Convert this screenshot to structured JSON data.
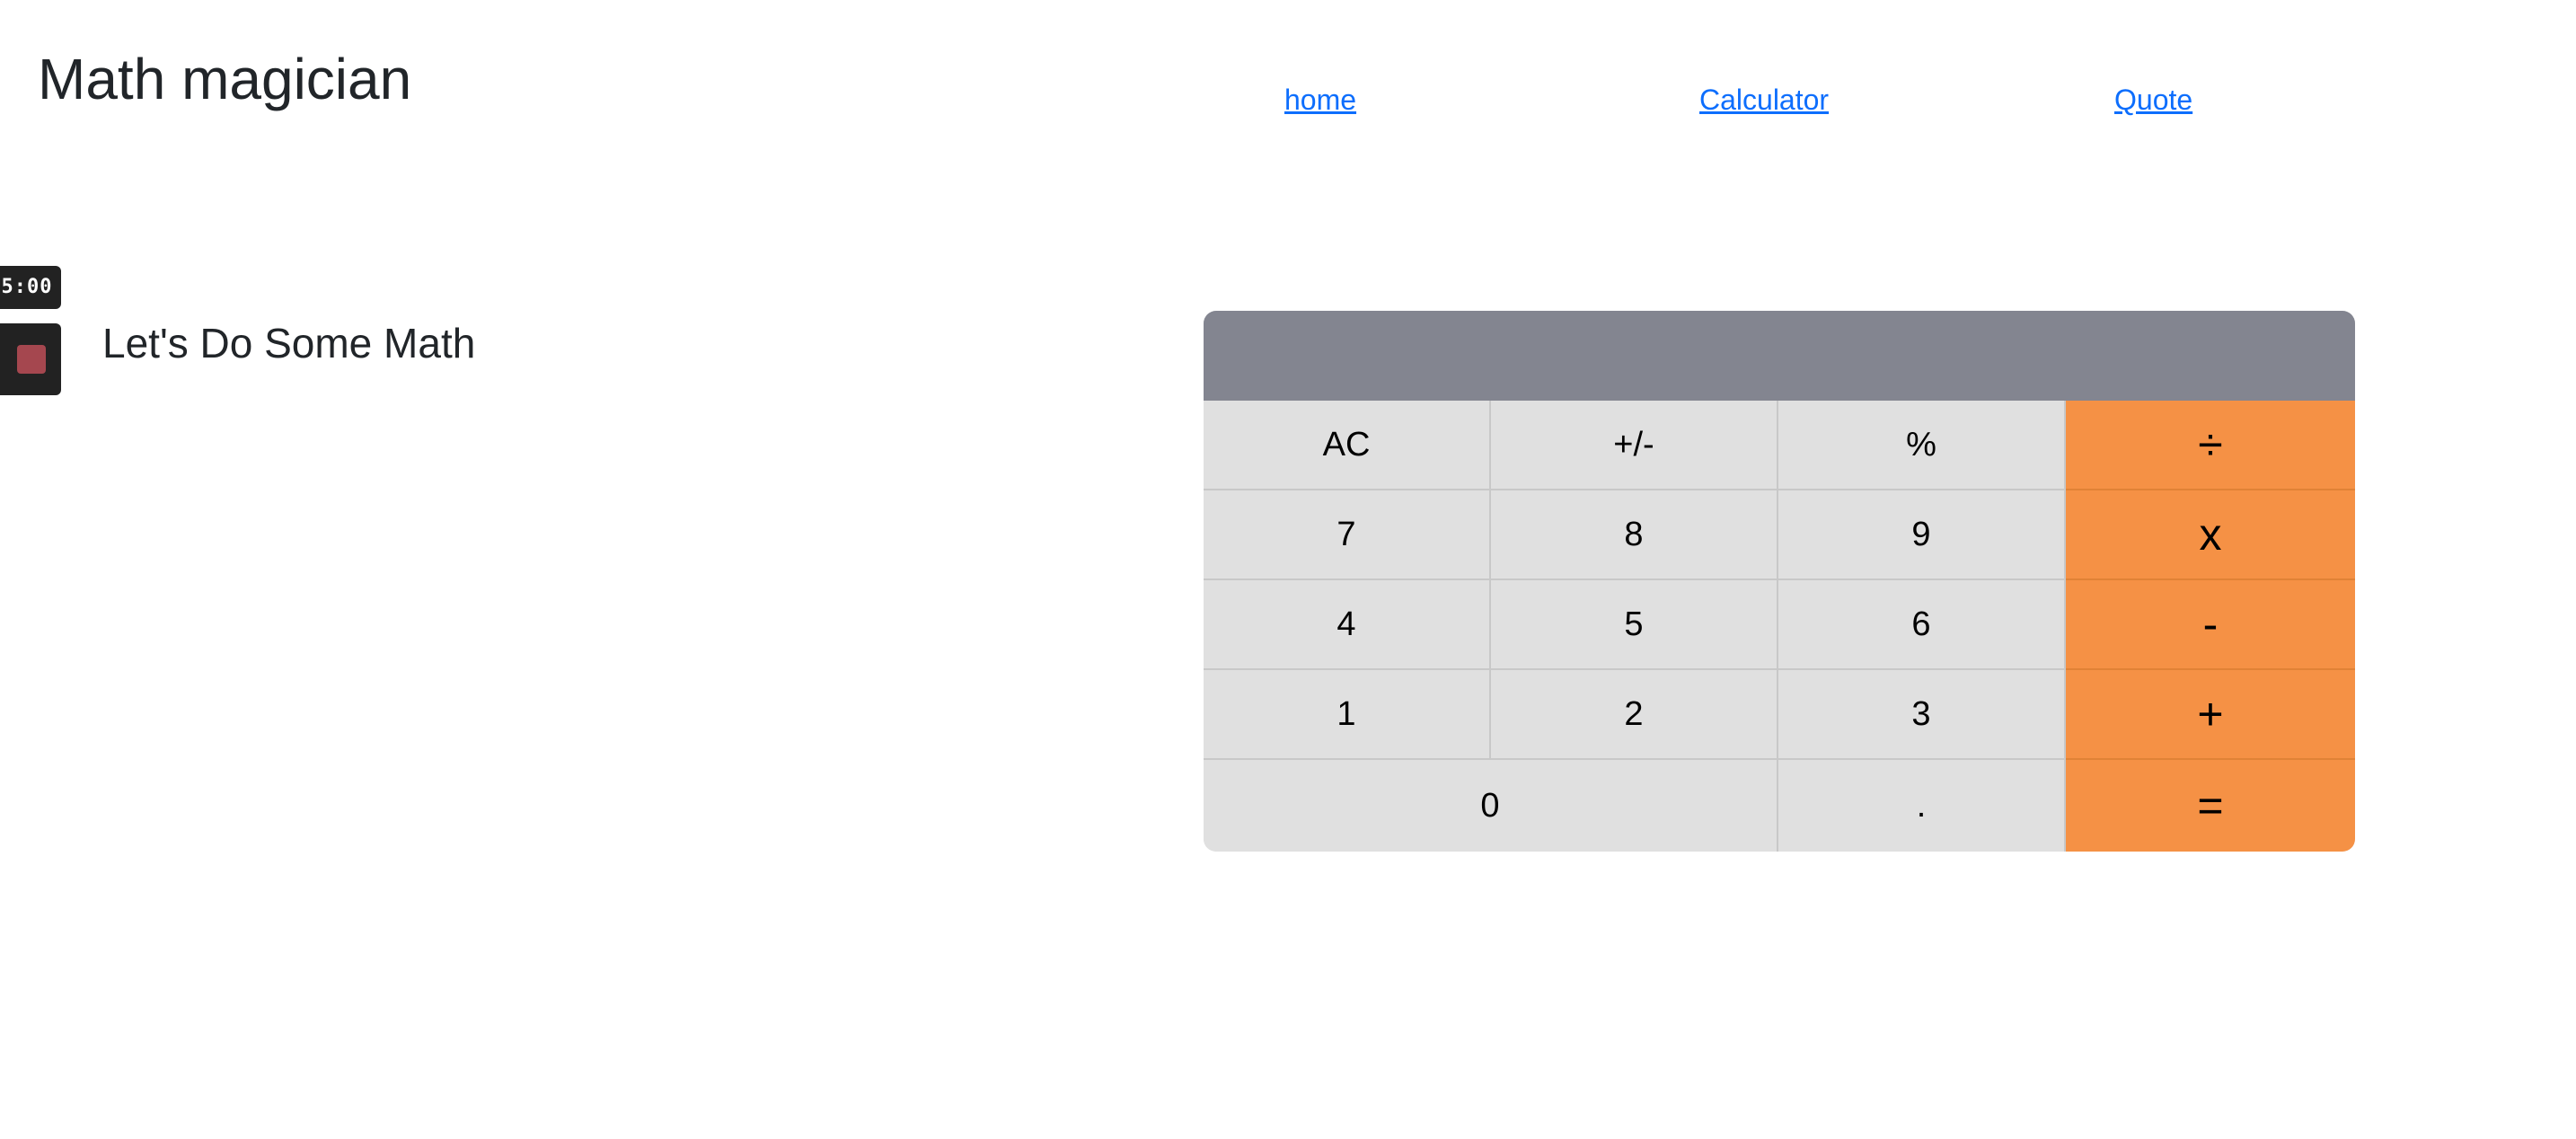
{
  "header": {
    "title": "Math magician",
    "nav": {
      "home": "home",
      "calculator": "Calculator",
      "quote": "Quote"
    }
  },
  "recorder": {
    "timer": "5:00"
  },
  "main": {
    "heading": "Let's Do Some Math"
  },
  "calculator": {
    "display": "",
    "keys": {
      "ac": "AC",
      "sign": "+/-",
      "percent": "%",
      "divide": "÷",
      "seven": "7",
      "eight": "8",
      "nine": "9",
      "multiply": "x",
      "four": "4",
      "five": "5",
      "six": "6",
      "minus": "-",
      "one": "1",
      "two": "2",
      "three": "3",
      "plus": "+",
      "zero": "0",
      "dot": ".",
      "equals": "="
    }
  },
  "colors": {
    "display_bg": "#838590",
    "key_bg": "#e0e0e0",
    "operator_bg": "#f59145",
    "link": "#0d6efd"
  }
}
